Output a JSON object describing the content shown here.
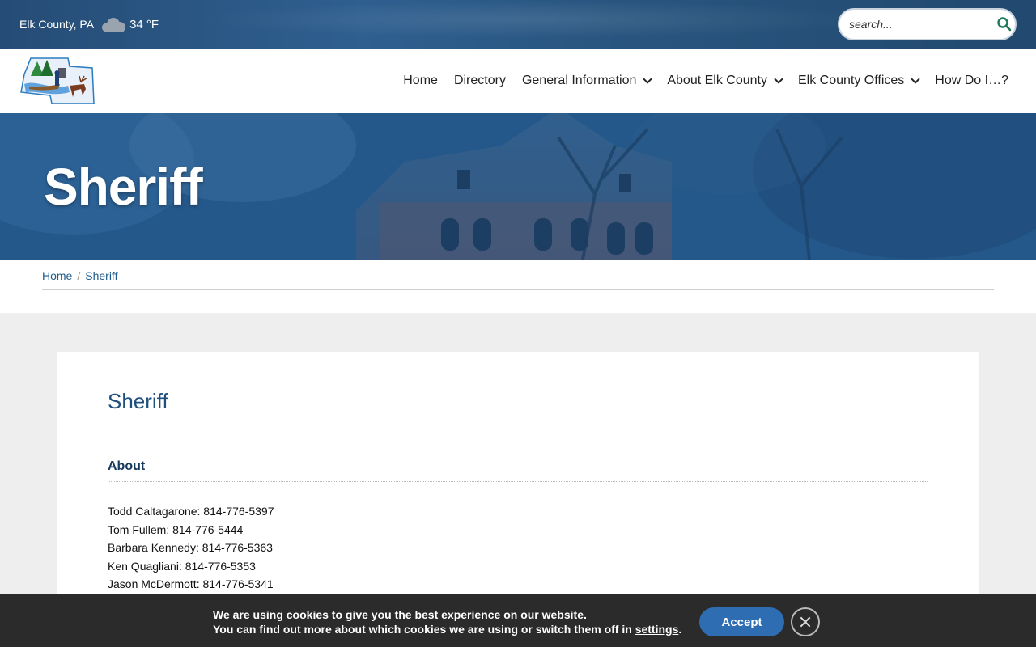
{
  "topbar": {
    "location": "Elk County, PA",
    "weather_icon": "cloud-icon",
    "temperature": "34 °F",
    "search_placeholder": "search..."
  },
  "header": {
    "logo_icon": "elk-county-logo",
    "nav": [
      {
        "label": "Home",
        "has_dropdown": false
      },
      {
        "label": "Directory",
        "has_dropdown": false
      },
      {
        "label": "General Information",
        "has_dropdown": true
      },
      {
        "label": "About Elk County",
        "has_dropdown": true
      },
      {
        "label": "Elk County Offices",
        "has_dropdown": true
      },
      {
        "label": "How Do I…?",
        "has_dropdown": false
      }
    ]
  },
  "hero": {
    "title": "Sheriff"
  },
  "breadcrumb": {
    "home": "Home",
    "separator": "/",
    "current": "Sheriff"
  },
  "content": {
    "title": "Sheriff",
    "section_heading": "About",
    "contacts": [
      "Todd Caltagarone: 814-776-5397",
      "Tom Fullem: 814-776-5444",
      "Barbara Kennedy: 814-776-5363",
      "Ken Quagliani: 814-776-5353",
      "Jason McDermott: 814-776-5341"
    ]
  },
  "cookie_banner": {
    "line1": "We are using cookies to give you the best experience on our website.",
    "line2_prefix": "You can find out more about which cookies we are using or switch them off in ",
    "settings_link": "settings",
    "line2_suffix": ".",
    "accept_label": "Accept",
    "close_icon": "close-icon"
  },
  "colors": {
    "brand_blue": "#1e5b8c",
    "accept_button": "#2f6db3",
    "search_icon": "#1a7a5a"
  }
}
